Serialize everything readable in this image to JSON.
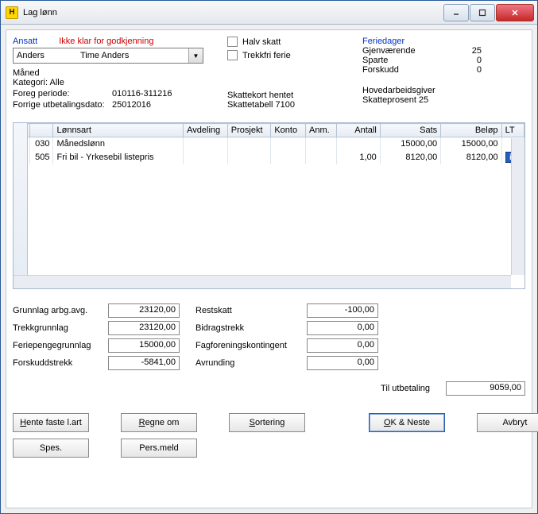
{
  "window": {
    "title": "Lag lønn"
  },
  "header": {
    "ansatt_label": "Ansatt",
    "warn": "Ikke klar for godkjenning",
    "employee_first": "Anders",
    "employee_last": "Time Anders",
    "maned": "Måned",
    "kategori": "Kategori: Alle",
    "foreg_label": "Foreg periode:",
    "foreg_value": "010116-311216",
    "forrige_label": "Forrige utbetalingsdato:",
    "forrige_value": "25012016"
  },
  "checks": {
    "halv_skatt": "Halv skatt",
    "trekkfri": "Trekkfri ferie"
  },
  "tax": {
    "hentet": "Skattekort hentet",
    "tabell": "Skattetabell 7100",
    "hoved": "Hovedarbeidsgiver",
    "prosent": "Skatteprosent 25"
  },
  "ferie": {
    "head": "Feriedager",
    "rows": [
      {
        "label": "Gjenværende",
        "value": "25"
      },
      {
        "label": "Sparte",
        "value": "0"
      },
      {
        "label": "Forskudd",
        "value": "0"
      }
    ]
  },
  "grid": {
    "cols": {
      "code": "",
      "lart": "Lønnsart",
      "avd": "Avdeling",
      "pro": "Prosjekt",
      "konto": "Konto",
      "anm": "Anm.",
      "antall": "Antall",
      "sats": "Sats",
      "belop": "Beløp",
      "lt": "LT"
    },
    "rows": [
      {
        "code": "030",
        "lart": "Månedslønn",
        "antall": "",
        "sats": "15000,00",
        "belop": "15000,00",
        "lt": ""
      },
      {
        "code": "505",
        "lart": "Fri bil - Yrkesebil listepris",
        "antall": "1,00",
        "sats": "8120,00",
        "belop": "8120,00",
        "lt": "info"
      }
    ]
  },
  "summary_left": [
    {
      "label": "Grunnlag arbg.avg.",
      "value": "23120,00"
    },
    {
      "label": "Trekkgrunnlag",
      "value": "23120,00"
    },
    {
      "label": "Feriepengegrunnlag",
      "value": "15000,00"
    },
    {
      "label": "Forskuddstrekk",
      "value": "-5841,00"
    }
  ],
  "summary_right": [
    {
      "label": "Restskatt",
      "value": "-100,00"
    },
    {
      "label": "Bidragstrekk",
      "value": "0,00"
    },
    {
      "label": "Fagforeningskontingent",
      "value": "0,00"
    },
    {
      "label": "Avrunding",
      "value": "0,00"
    }
  ],
  "payout": {
    "label": "Til utbetaling",
    "value": "9059,00"
  },
  "buttons": {
    "hente": "Hente faste l.art",
    "regne": "Regne om",
    "sort": "Sortering",
    "ok": "OK & Neste",
    "avbryt": "Avbryt",
    "spes": "Spes.",
    "pers": "Pers.meld"
  }
}
